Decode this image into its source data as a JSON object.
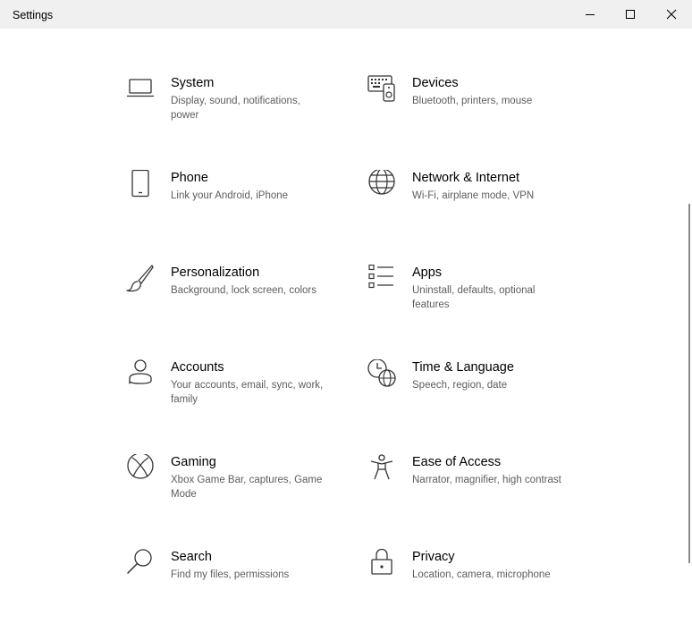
{
  "window": {
    "title": "Settings"
  },
  "tiles": [
    {
      "id": "system",
      "title": "System",
      "desc": "Display, sound, notifications, power",
      "icon": "laptop-icon"
    },
    {
      "id": "devices",
      "title": "Devices",
      "desc": "Bluetooth, printers, mouse",
      "icon": "keyboard-devices-icon"
    },
    {
      "id": "phone",
      "title": "Phone",
      "desc": "Link your Android, iPhone",
      "icon": "phone-icon"
    },
    {
      "id": "network",
      "title": "Network & Internet",
      "desc": "Wi-Fi, airplane mode, VPN",
      "icon": "globe-icon"
    },
    {
      "id": "personalization",
      "title": "Personalization",
      "desc": "Background, lock screen, colors",
      "icon": "paintbrush-icon"
    },
    {
      "id": "apps",
      "title": "Apps",
      "desc": "Uninstall, defaults, optional features",
      "icon": "apps-list-icon"
    },
    {
      "id": "accounts",
      "title": "Accounts",
      "desc": "Your accounts, email, sync, work, family",
      "icon": "person-icon"
    },
    {
      "id": "time-language",
      "title": "Time & Language",
      "desc": "Speech, region, date",
      "icon": "clock-globe-icon"
    },
    {
      "id": "gaming",
      "title": "Gaming",
      "desc": "Xbox Game Bar, captures, Game Mode",
      "icon": "xbox-icon"
    },
    {
      "id": "ease-of-access",
      "title": "Ease of Access",
      "desc": "Narrator, magnifier, high contrast",
      "icon": "accessibility-icon"
    },
    {
      "id": "search",
      "title": "Search",
      "desc": "Find my files, permissions",
      "icon": "search-icon"
    },
    {
      "id": "privacy",
      "title": "Privacy",
      "desc": "Location, camera, microphone",
      "icon": "lock-icon"
    }
  ]
}
